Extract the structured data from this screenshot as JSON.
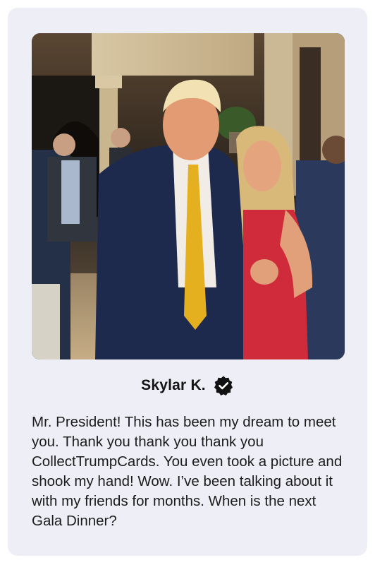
{
  "card": {
    "photo_alt": "Photo of Skylar K. with Donald Trump",
    "author_name": "Skylar K.",
    "verified_icon": "verified-badge-icon",
    "testimonial_text": "Mr. President! This has been my dream to meet you. Thank you thank you thank you CollectTrumpCards. You even took a picture and shook my hand! Wow. I’ve been talking about it with my friends for months. When is the next Gala Dinner?"
  },
  "colors": {
    "card_background": "#eeeef6",
    "text": "#1c1c1c",
    "badge": "#111111"
  }
}
